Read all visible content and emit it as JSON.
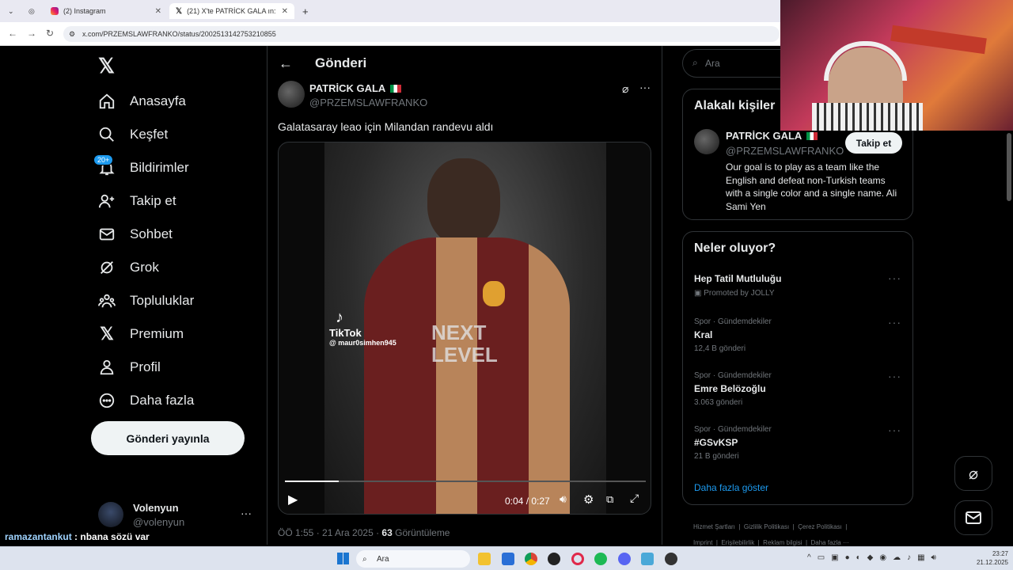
{
  "browser": {
    "tabs": [
      {
        "label": "(2) Instagram"
      },
      {
        "label": "(21) X'te PATRİCK GALA ın: \"Gal"
      }
    ],
    "url": "x.com/PRZEMSLAWFRANKO/status/2002513142753210855"
  },
  "sidebar": {
    "items": [
      {
        "label": "Anasayfa",
        "icon": "home-icon"
      },
      {
        "label": "Keşfet",
        "icon": "search-icon"
      },
      {
        "label": "Bildirimler",
        "icon": "bell-icon"
      },
      {
        "label": "Takip et",
        "icon": "person-add-icon"
      },
      {
        "label": "Sohbet",
        "icon": "mail-icon"
      },
      {
        "label": "Grok",
        "icon": "grok-icon"
      },
      {
        "label": "Topluluklar",
        "icon": "communities-icon"
      },
      {
        "label": "Premium",
        "icon": "x-logo-icon"
      },
      {
        "label": "Profil",
        "icon": "profile-icon"
      },
      {
        "label": "Daha fazla",
        "icon": "more-circle-icon"
      }
    ],
    "notification_badge": "20+",
    "post_button": "Gönderi yayınla",
    "account": {
      "name": "Volenyun",
      "handle": "@volenyun"
    }
  },
  "main": {
    "header_title": "Gönderi",
    "author_name": "PATRİCK GALA",
    "author_handle": "@PRZEMSLAWFRANKO",
    "text": "Galatasaray leao için Milandan randevu aldı",
    "video": {
      "current_time": "0:04",
      "duration": "0:27",
      "progress": 0.15,
      "watermark_brand": "TikTok",
      "watermark_user": "@ maur0simhen945"
    },
    "meta_time": "ÖÖ 1:55 · 21 Ara 2025 · ",
    "views_count": "63",
    "views_label": " Görüntüleme"
  },
  "right": {
    "search_placeholder": "Ara",
    "related_title": "Alakalı kişiler",
    "related_person": {
      "name": "PATRİCK GALA",
      "handle": "@PRZEMSLAWFRANKO",
      "follow_label": "Takip et",
      "bio": "Our goal is to play as a team like the English and defeat non-Turkish teams with a single color and a single name. Ali Sami Yen"
    },
    "trends_title": "Neler oluyor?",
    "trends": [
      {
        "category": "",
        "title": "Hep Tatil Mutluluğu",
        "sub": "Promoted by JOLLY"
      },
      {
        "category": "Spor · Gündemdekiler",
        "title": "Kral",
        "sub": "12,4 B gönderi"
      },
      {
        "category": "Spor · Gündemdekiler",
        "title": "Emre Belözoğlu",
        "sub": "3.063 gönderi"
      },
      {
        "category": "Spor · Gündemdekiler",
        "title": "#GSvKSP",
        "sub": "21 B gönderi"
      }
    ],
    "show_more": "Daha fazla göster",
    "footer_links": [
      "Hizmet Şartları",
      "Gizlilik Politikası",
      "Çerez Politikası",
      "Imprint",
      "Erişilebilirlik",
      "Reklam bilgisi",
      "Daha fazla ···"
    ]
  },
  "chat_overlay": {
    "user": "ramazantankut",
    "message": " : nbana sözü var"
  },
  "taskbar": {
    "search_placeholder": "Ara",
    "time": "23:27",
    "date": "21.12.2025"
  },
  "colors": {
    "accent": "#1d9bf0",
    "background": "#000000",
    "border": "#2f3336",
    "muted": "#71767b"
  }
}
